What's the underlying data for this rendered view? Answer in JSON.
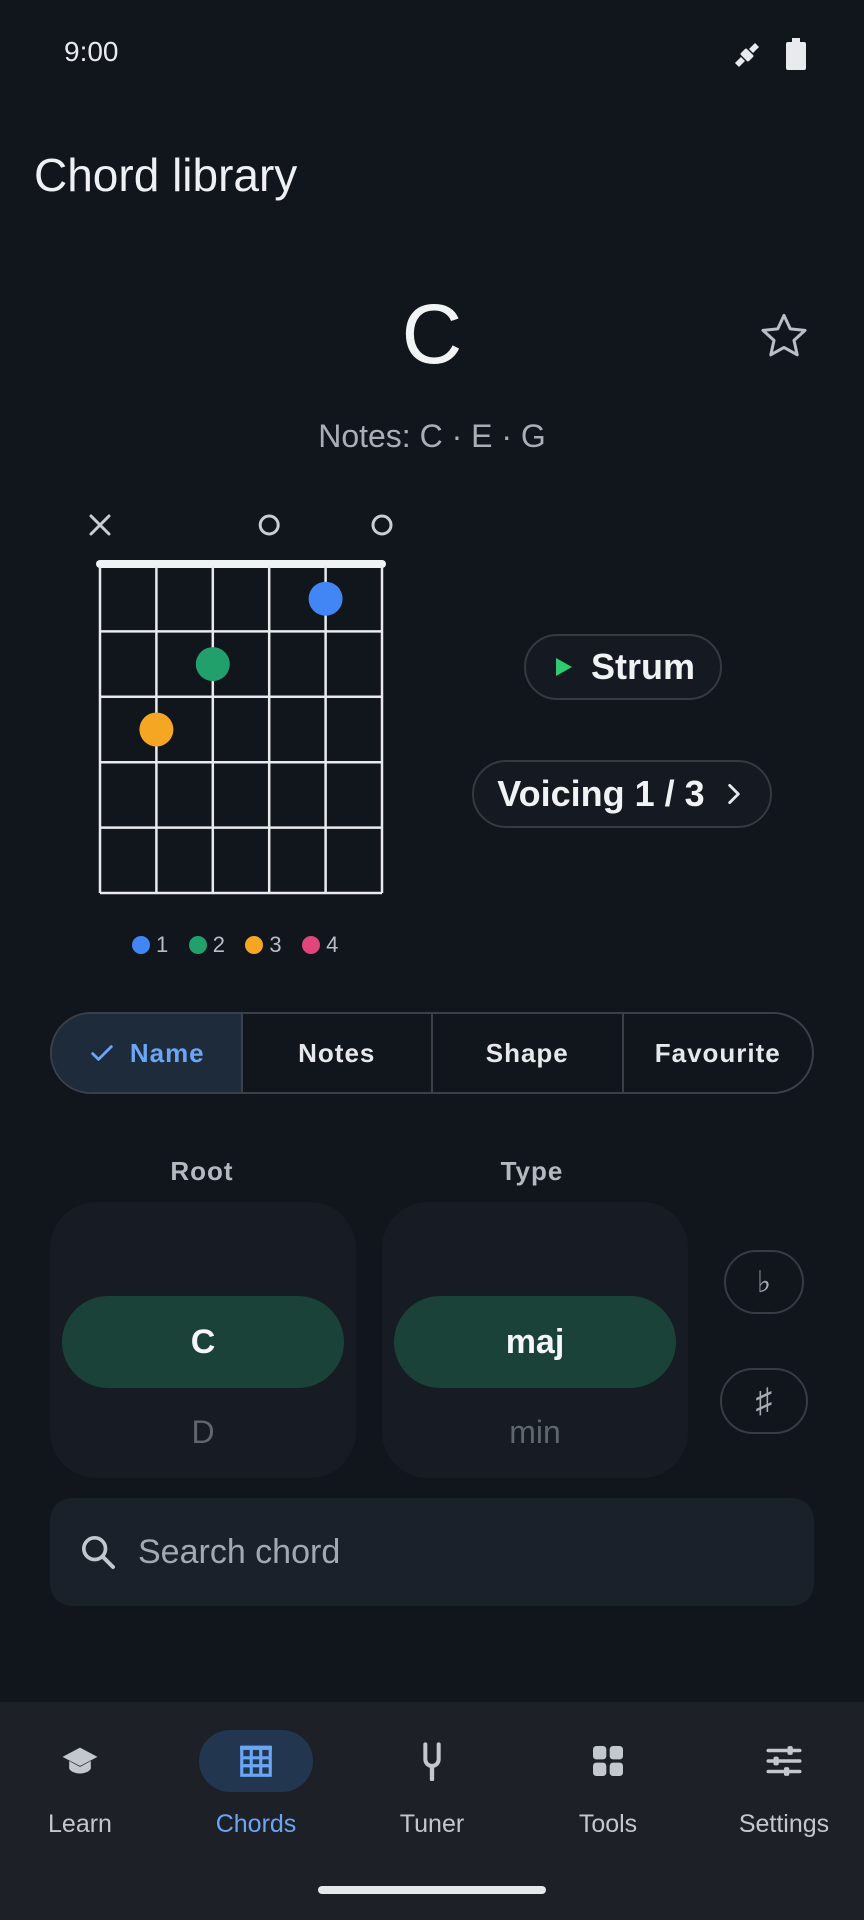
{
  "status_bar": {
    "time": "9:00"
  },
  "header": {
    "title": "Chord library"
  },
  "chord": {
    "name": "C",
    "notes_text": "Notes: C · E · G",
    "string_markers": [
      "×",
      "",
      "",
      "o",
      "",
      "o"
    ],
    "fingers": [
      {
        "string": 5,
        "fret": 3,
        "finger": 3
      },
      {
        "string": 4,
        "fret": 2,
        "finger": 2
      },
      {
        "string": 2,
        "fret": 1,
        "finger": 1
      }
    ],
    "fret_count": 5,
    "string_count": 6
  },
  "legend": [
    {
      "label": "1",
      "color": "#4285f4"
    },
    {
      "label": "2",
      "color": "#22a06b"
    },
    {
      "label": "3",
      "color": "#f5a623"
    },
    {
      "label": "4",
      "color": "#e0467c"
    }
  ],
  "actions": {
    "strum_label": "Strum",
    "voicing_label": "Voicing 1 / 3"
  },
  "tabs": [
    {
      "label": "Name",
      "active": true
    },
    {
      "label": "Notes",
      "active": false
    },
    {
      "label": "Shape",
      "active": false
    },
    {
      "label": "Favourite",
      "active": false
    }
  ],
  "pickers": {
    "root": {
      "label": "Root",
      "selected": "C",
      "next": "D"
    },
    "type": {
      "label": "Type",
      "selected": "maj",
      "next": "min"
    },
    "flat_label": "♭",
    "sharp_label": "♯"
  },
  "search": {
    "placeholder": "Search chord"
  },
  "nav": [
    {
      "label": "Learn",
      "icon": "school-icon",
      "active": false
    },
    {
      "label": "Chords",
      "icon": "chord-grid-icon",
      "active": true
    },
    {
      "label": "Tuner",
      "icon": "tuning-fork-icon",
      "active": false
    },
    {
      "label": "Tools",
      "icon": "apps-grid-icon",
      "active": false
    },
    {
      "label": "Settings",
      "icon": "sliders-icon",
      "active": false
    }
  ],
  "colors": {
    "background": "#11151c",
    "accent": "#6aa6f3",
    "selection": "#1a4238",
    "finger1": "#4285f4",
    "finger2": "#22a06b",
    "finger3": "#f5a623",
    "finger4": "#e0467c",
    "strum_play": "#2ecc71"
  }
}
